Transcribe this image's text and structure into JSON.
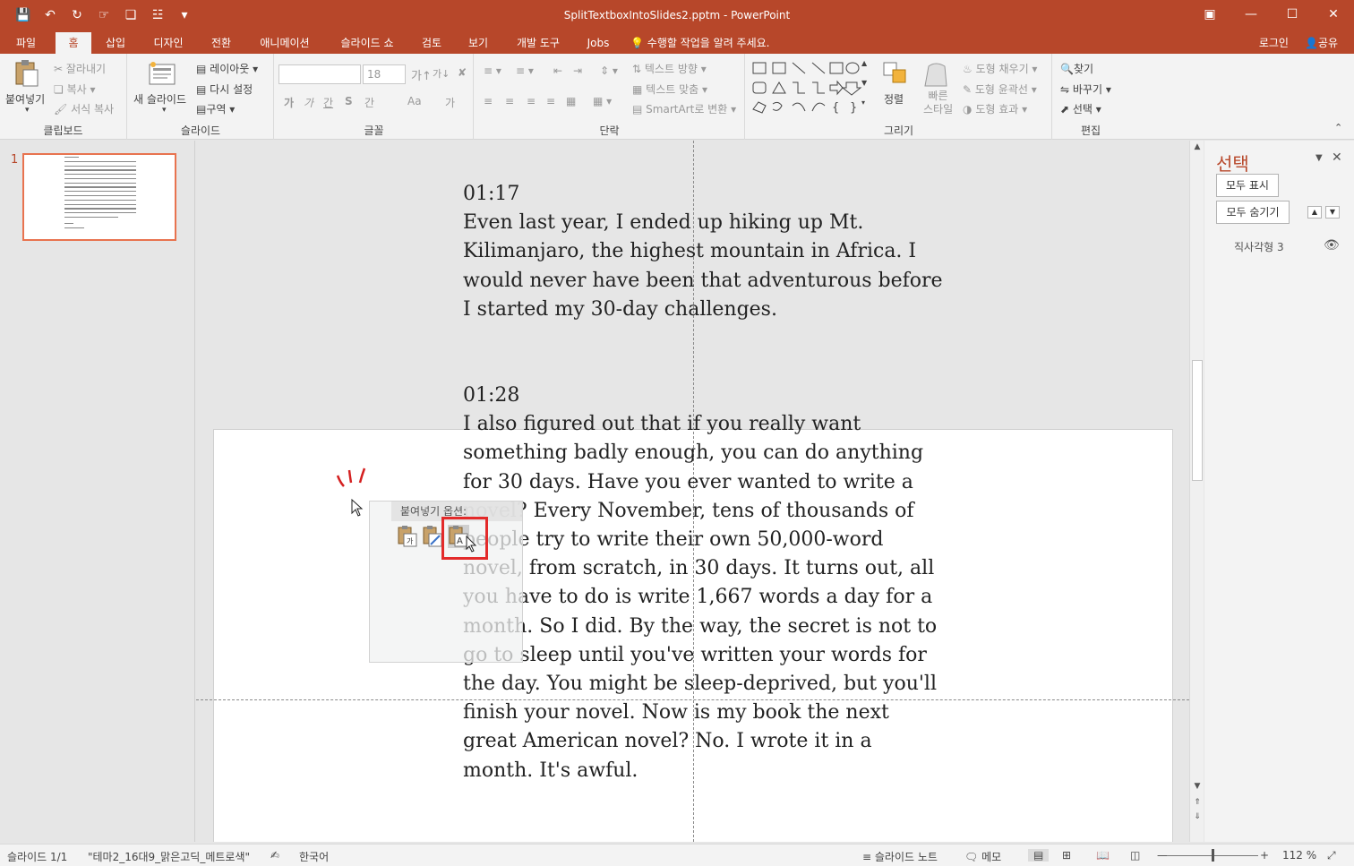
{
  "window": {
    "title": "SplitTextboxIntoSlides2.pptm - PowerPoint"
  },
  "tabs": [
    "파일",
    "홈",
    "삽입",
    "디자인",
    "전환",
    "애니메이션",
    "슬라이드 쇼",
    "검토",
    "보기",
    "개발 도구",
    "Jobs"
  ],
  "tell_me": "수행할 작업을 알려 주세요.",
  "account": {
    "login": "로그인",
    "share": "공유"
  },
  "ribbon": {
    "clipboard": {
      "label": "클립보드",
      "paste": "붙여넣기",
      "cut": "잘라내기",
      "copy": "복사",
      "format_painter": "서식 복사"
    },
    "slides": {
      "label": "슬라이드",
      "new_slide": "새 슬라이드",
      "layout": "레이아웃",
      "reset": "다시 설정",
      "section": "구역"
    },
    "font": {
      "label": "글꼴",
      "size": "18",
      "btn_bold": "가",
      "btn_italic": "가",
      "btn_underline": "간",
      "btn_strike": "S",
      "btn_spacing": "간",
      "btn_case": "Aa",
      "btn_clear": "가"
    },
    "paragraph": {
      "label": "단락",
      "text_direction": "텍스트 방향",
      "align_text": "텍스트 맞춤",
      "smartart": "SmartArt로 변환"
    },
    "drawing": {
      "label": "그리기",
      "arrange": "정렬",
      "quick_styles": "빠른\n스타일",
      "shape_fill": "도형 채우기",
      "shape_outline": "도형 윤곽선",
      "shape_effects": "도형 효과"
    },
    "editing": {
      "label": "편집",
      "find": "찾기",
      "replace": "바꾸기",
      "select": "선택"
    }
  },
  "thumbnail": {
    "number": "1"
  },
  "textbox": {
    "paragraphs": [
      {
        "time": "01:17",
        "text": "Even last year, I ended up hiking up Mt. Kilimanjaro, the highest mountain in Africa. I would never have been that adventurous before I started my 30-day challenges."
      },
      {
        "time": "01:28",
        "text": "I also figured out that if you really want something badly enough, you can do anything for 30 days. Have you ever wanted to write a novel? Every November, tens of thousands of people try to write their own 50,000-word novel, from scratch, in 30 days. It turns out, all you have to do is write 1,667 words a day for a month. So I did. By the way, the secret is not to go to sleep until you've written your words for the day. You might be sleep-deprived, but you'll finish your novel. Now is my book the next great American novel? No. I wrote it in a month. It's awful."
      }
    ]
  },
  "paste_options": {
    "header": "붙여넣기 옵션:"
  },
  "selection_pane": {
    "title": "선택",
    "show_all": "모두 표시",
    "hide_all": "모두 숨기기",
    "items": [
      "직사각형 3"
    ]
  },
  "status": {
    "slide": "슬라이드 1/1",
    "theme": "\"테마2_16대9_맑은고딕_메트로색\"",
    "language": "한국어",
    "notes": "슬라이드 노트",
    "comments": "메모",
    "zoom": "112 %",
    "zoom_fraction": 0.5
  },
  "colors": {
    "accent": "#b7472a",
    "highlight": "#e32a2a"
  }
}
